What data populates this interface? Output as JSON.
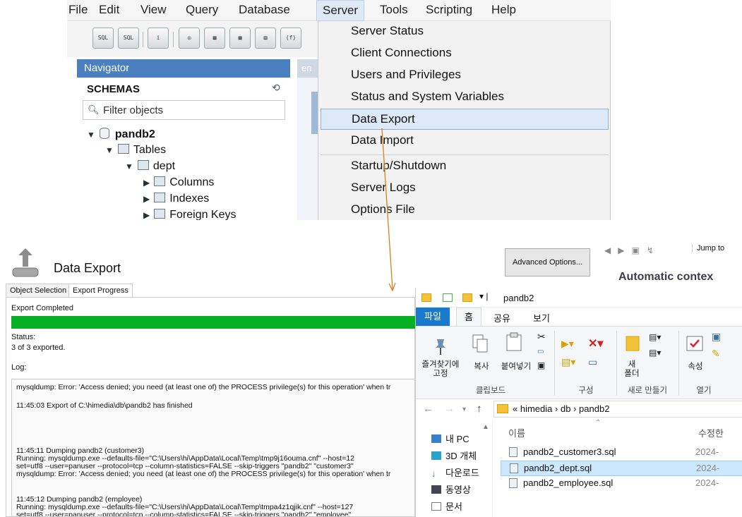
{
  "menu": {
    "items": [
      "File",
      "Edit",
      "View",
      "Query",
      "Database",
      "Server",
      "Tools",
      "Scripting",
      "Help"
    ]
  },
  "toolbar": {
    "icons": [
      "new-sql-tab-icon",
      "open-sql-file-icon",
      "inspector-icon",
      "create-schema-icon",
      "create-table-icon",
      "create-view-icon",
      "create-procedure-icon",
      "create-function-icon"
    ]
  },
  "navigator": {
    "title": "Navigator",
    "tab_fragment": "en",
    "schemas_label": "SCHEMAS",
    "filter_placeholder": "Filter objects",
    "tree": {
      "schema": "pandb2",
      "tables": "Tables",
      "table": "dept",
      "columns": "Columns",
      "indexes": "Indexes",
      "foreign_keys": "Foreign Keys"
    }
  },
  "server_menu": {
    "items": [
      "Server Status",
      "Client Connections",
      "Users and Privileges",
      "Status and System Variables",
      "Data Export",
      "Data Import",
      "Startup/Shutdown",
      "Server Logs",
      "Options File"
    ],
    "highlighted": "Data Export"
  },
  "data_export": {
    "title": "Data Export",
    "tabs": [
      "Object Selection",
      "Export Progress"
    ],
    "active_tab": "Export Progress",
    "status_heading": "Export Completed",
    "progress": 1.0,
    "status_label": "Status:",
    "status_value": "3 of 3 exported.",
    "log_label": "Log:",
    "advanced_button": "Advanced Options...",
    "log_lines": [
      "mysqldump: Error: 'Access denied; you need (at least one of) the PROCESS privilege(s) for this operation' when tr",
      "11:45:03 Export of C:\\himedia\\db\\pandb2 has finished",
      "11:45:11 Dumping pandb2 (customer3)",
      "Running: mysqldump.exe --defaults-file=\"C:\\Users\\hi\\AppData\\Local\\Temp\\tmp9j16ouma.cnf\"  --host=12",
      "set=utf8 --user=panuser --protocol=tcp --column-statistics=FALSE --skip-triggers \"pandb2\" \"customer3\"",
      "mysqldump: Error: 'Access denied; you need (at least one of) the PROCESS privilege(s) for this operation' when tr",
      "11:45:12 Dumping pandb2 (employee)",
      "Running: mysqldump.exe --defaults-file=\"C:\\Users\\hi\\AppData\\Local\\Temp\\tmpa4z1qjik.cnf\"  --host=127",
      "set=utf8 --user=panuser --protocol=tcp --column-statistics=FALSE --skip-triggers \"pandb2\" \"employee\""
    ]
  },
  "help_panel": {
    "jump": "Jump to",
    "heading": "Automatic contex"
  },
  "explorer": {
    "title": "pandb2",
    "ribbon_tabs": [
      "파일",
      "홈",
      "공유",
      "보기"
    ],
    "ribbon": {
      "pin": "즐겨찾기에\n고정",
      "copy": "복사",
      "paste": "붙여넣기",
      "new_folder": "새\n폴더",
      "properties": "속성",
      "groups": [
        "클립보드",
        "구성",
        "새로 만들기",
        "열기"
      ]
    },
    "address": [
      "«",
      "himedia",
      "›",
      "db",
      "›",
      "pandb2"
    ],
    "nav": [
      "내 PC",
      "3D 개체",
      "다운로드",
      "동영상",
      "문서"
    ],
    "columns": [
      "이름",
      "수정한"
    ],
    "files": [
      {
        "name": "pandb2_customer3.sql",
        "date": "2024-"
      },
      {
        "name": "pandb2_dept.sql",
        "date": "2024-",
        "selected": true
      },
      {
        "name": "pandb2_employee.sql",
        "date": "2024-"
      }
    ]
  },
  "colors": {
    "accent": "#4a7fc0",
    "progress": "#06b025",
    "arrow": "#e07b20",
    "explorer_file_tab": "#1979ca"
  }
}
